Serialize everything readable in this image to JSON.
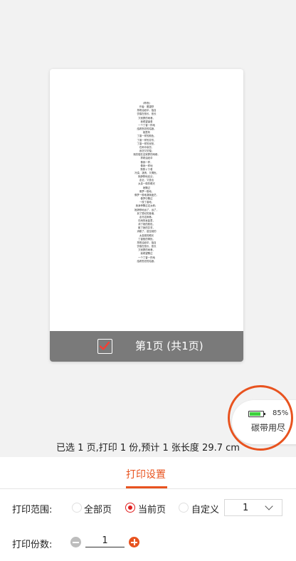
{
  "preview": {
    "poem_lines": [
      "《昨夜》",
      "作者：戴望舒",
      "撑着油纸伞，独自",
      "彷徨在悠长、悠长",
      "又寂寥的雨巷，",
      "我希望逢着",
      "一个丁香一样地",
      "结着愁怨的姑娘。",
      "她是有",
      "丁香一样的颜色，",
      "丁香一样的芬芳，",
      "丁香一样的忧愁，",
      "在雨中哀怨，",
      "哀怨又彷徨；",
      "她彷徨在这寂寥的雨巷，",
      "撑着油纸伞",
      "像我一样，",
      "像我一样地",
      "默默彳亍着",
      "冷漠、凄清，又惆怅。",
      "她静默地走近，",
      "走近，又投出",
      "太息一般的眼光",
      "她飘过",
      "像梦一般地，",
      "像梦一般地凄婉迷茫。",
      "像梦中飘过",
      "一枝丁香地，",
      "我身旁飘过这女郎；",
      "她静默地远了，远了，",
      "到了颓圮的篱墙，",
      "走尽这雨巷。",
      "在雨的哀曲里，",
      "消了她的颜色，",
      "散了她的芬芳，",
      "消散了，甚至她的",
      "太息般的眼光",
      "丁香般的惆怅。",
      "撑着油纸伞，独自",
      "彷徨在悠长、悠长",
      "又寂寥的雨巷，",
      "我希望飘过",
      "一个丁香一样地",
      "结着愁怨的姑娘。"
    ],
    "page_label": "第1页 (共1页)",
    "page_checked": true
  },
  "battery": {
    "percent_text": "85%",
    "level": 0.85,
    "status": "碳带用尽",
    "fill_color": "#3cd13c",
    "ring_color": "#e8531f"
  },
  "summary": "已选 1 页,打印 1 份,预计 1 张长度 29.7 cm",
  "settings": {
    "tab_label": "打印设置",
    "accent": "#e8531f",
    "range_label": "打印范围:",
    "range_options": [
      "全部页",
      "当前页",
      "自定义"
    ],
    "range_selected": "当前页",
    "custom_value": "1",
    "copies_label": "打印份数:",
    "copies_value": "1"
  }
}
